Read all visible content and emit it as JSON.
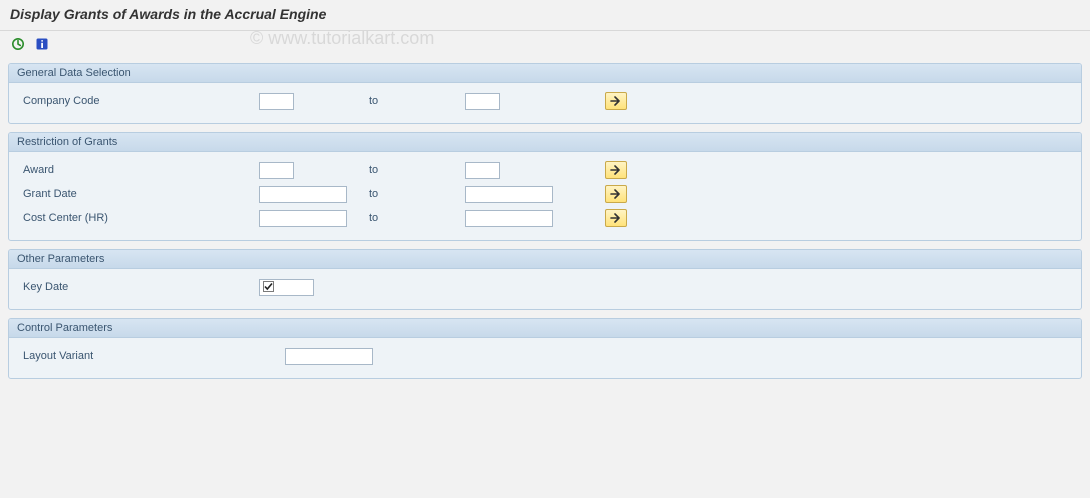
{
  "title": "Display Grants of Awards in the Accrual Engine",
  "watermark": "© www.tutorialkart.com",
  "toolbar": {
    "execute_icon": "execute",
    "info_icon": "info"
  },
  "groups": {
    "general": {
      "header": "General Data Selection",
      "company_code_label": "Company Code",
      "to_label": "to",
      "company_code_from": "",
      "company_code_to": ""
    },
    "restriction": {
      "header": "Restriction of Grants",
      "award_label": "Award",
      "grant_date_label": "Grant Date",
      "cost_center_label": "Cost Center (HR)",
      "to_label": "to",
      "award_from": "",
      "award_to": "",
      "grant_date_from": "",
      "grant_date_to": "",
      "cost_center_from": "",
      "cost_center_to": ""
    },
    "other": {
      "header": "Other Parameters",
      "key_date_label": "Key Date",
      "key_date_value": ""
    },
    "control": {
      "header": "Control Parameters",
      "layout_variant_label": "Layout Variant",
      "layout_variant_value": ""
    }
  }
}
